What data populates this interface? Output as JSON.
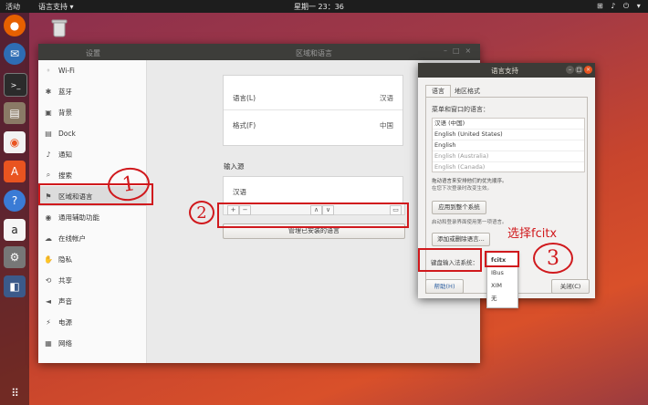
{
  "topbar": {
    "activities": "活动",
    "app_menu": "语言支持 ▾",
    "clock": "星期一 23：36",
    "tray": "⊞ ♪ ⏻ ▾"
  },
  "settings": {
    "header_left": "设置",
    "header_center": "区域和语言",
    "sidebar": [
      {
        "icon": "wifi-icon",
        "glyph": "◦",
        "label": "Wi-Fi"
      },
      {
        "icon": "bluetooth-icon",
        "glyph": "✱",
        "label": "蓝牙"
      },
      {
        "icon": "background-icon",
        "glyph": "▣",
        "label": "背景"
      },
      {
        "icon": "dock-icon",
        "glyph": "▤",
        "label": "Dock"
      },
      {
        "icon": "bell-icon",
        "glyph": "♪",
        "label": "通知"
      },
      {
        "icon": "search-icon",
        "glyph": "⌕",
        "label": "搜索"
      },
      {
        "icon": "region-flag-icon",
        "glyph": "⚑",
        "label": "区域和语言"
      },
      {
        "icon": "accessibility-icon",
        "glyph": "◉",
        "label": "通用辅助功能"
      },
      {
        "icon": "online-accounts-icon",
        "glyph": "☁",
        "label": "在线帐户"
      },
      {
        "icon": "privacy-icon",
        "glyph": "✋",
        "label": "隐私"
      },
      {
        "icon": "share-icon",
        "glyph": "⟲",
        "label": "共享"
      },
      {
        "icon": "sound-icon",
        "glyph": "◄",
        "label": "声音"
      },
      {
        "icon": "power-icon",
        "glyph": "⚡",
        "label": "电源"
      },
      {
        "icon": "network-icon",
        "glyph": "▦",
        "label": "网络"
      }
    ],
    "language_label": "语言(L)",
    "language_value": "汉语",
    "formats_label": "格式(F)",
    "formats_value": "中国",
    "input_sources_title": "输入源",
    "input_source_item": "汉语",
    "add": "+",
    "remove": "−",
    "up": "∧",
    "down": "∨",
    "manage_button": "管理已安装的语言"
  },
  "lang_dialog": {
    "title": "语言支持",
    "tab_language": "语言",
    "tab_regional": "地区格式",
    "list_label": "菜单和窗口的语言：",
    "languages": [
      "汉语 (中国)",
      "English (United States)",
      "English",
      "English (Australia)",
      "English (Canada)"
    ],
    "hint1": "拖动语言来安排他们的优先顺序。",
    "hint2": "在您下次登录时改变生效。",
    "apply_button": "应用到整个系统",
    "hint3": "启动和登录界面使用第一项语言。",
    "add_remove_button": "添加或删除语言...",
    "keyboard_label": "键盘输入法系统：",
    "help_button": "帮助(H)",
    "close_button": "关闭(C)"
  },
  "dropdown": {
    "options": [
      "fcitx",
      "IBus",
      "XIM",
      "无"
    ],
    "selected": "fcitx"
  },
  "annotations": {
    "circle1": "1",
    "circle2": "2",
    "circle3": "3",
    "select_label": "选择fcitx"
  },
  "colors": {
    "annotation": "#d0191d",
    "accent": "#e95420"
  }
}
